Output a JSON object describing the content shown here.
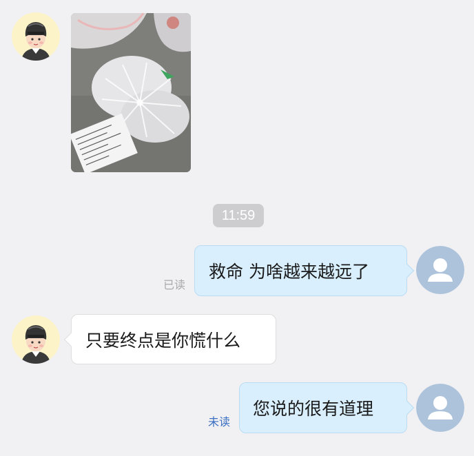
{
  "chat": {
    "time_badge": "11:59",
    "messages": [
      {
        "id": "m1",
        "sender": "courier",
        "kind": "image",
        "image_content": "photo-of-bagged-food-with-order-receipt-on-ground"
      },
      {
        "id": "m2",
        "sender": "me",
        "kind": "text",
        "text": "救命 为啥越来越远了",
        "status": "已读"
      },
      {
        "id": "m3",
        "sender": "courier",
        "kind": "text",
        "text": "只要终点是你慌什么"
      },
      {
        "id": "m4",
        "sender": "me",
        "kind": "text",
        "text": "您说的很有道理",
        "status": "未读"
      }
    ]
  },
  "avatars": {
    "courier": "courier-helmet-avatar",
    "me": "default-user-avatar"
  },
  "colors": {
    "background": "#f1f1f3",
    "my_bubble": "#d9effd",
    "their_bubble": "#ffffff",
    "time_badge": "#cdcdd0",
    "read_status": "#a9a9ad",
    "unread_status": "#3a6fc2",
    "default_avatar": "#adc3dc",
    "courier_avatar_bg": "#fdf3c8"
  }
}
